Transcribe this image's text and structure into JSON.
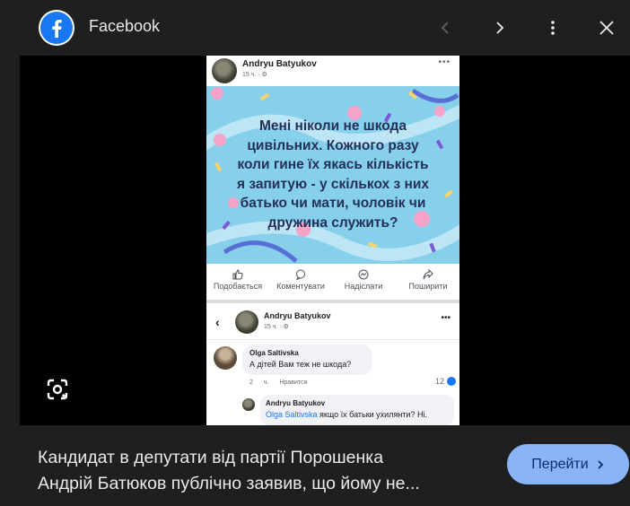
{
  "header": {
    "site_name": "Facebook",
    "icons": [
      "facebook-logo-icon",
      "chevron-left-icon",
      "chevron-right-icon",
      "more-vert-icon",
      "close-icon"
    ]
  },
  "post": {
    "author": "Andryu Batyukov",
    "meta": "15 ч. · ⚙",
    "banner_lines": [
      "Мені ніколи не шкода",
      "цивільних. Кожного разу",
      "коли гине їх якась кількість",
      "я запитую - у скількох з них",
      "батько чи мати, чоловік чи",
      "дружина служить?"
    ],
    "actions": [
      "Подобається",
      "Коментувати",
      "Надіслати",
      "Поширити"
    ]
  },
  "comments_view": {
    "back": "‹",
    "author": "Andryu Batyukov",
    "meta": "15 ч. · ⚙",
    "comment": {
      "name": "Olga Saltivska",
      "text": "А дітей Вам теж не шкода?",
      "time": "2 ч.",
      "like": "Нравится",
      "likes_count": "12"
    },
    "reply": {
      "name": "Andryu Batyukov",
      "mention": "Olga Saltivska",
      "text": " якщо їх батьки ухилянти? Ні."
    }
  },
  "caption": {
    "line1": "Кандидат в депутати від партії Порошенка",
    "line2": "Андрій Батюков публічно заявив, що йому не..."
  },
  "button": {
    "label": "Перейти",
    "icon": "chevron-right-icon"
  },
  "colors": {
    "background": "#1f1f1f",
    "button": "#8ab4f8",
    "facebook_blue": "#1877f2",
    "banner": "#86d0ec"
  }
}
